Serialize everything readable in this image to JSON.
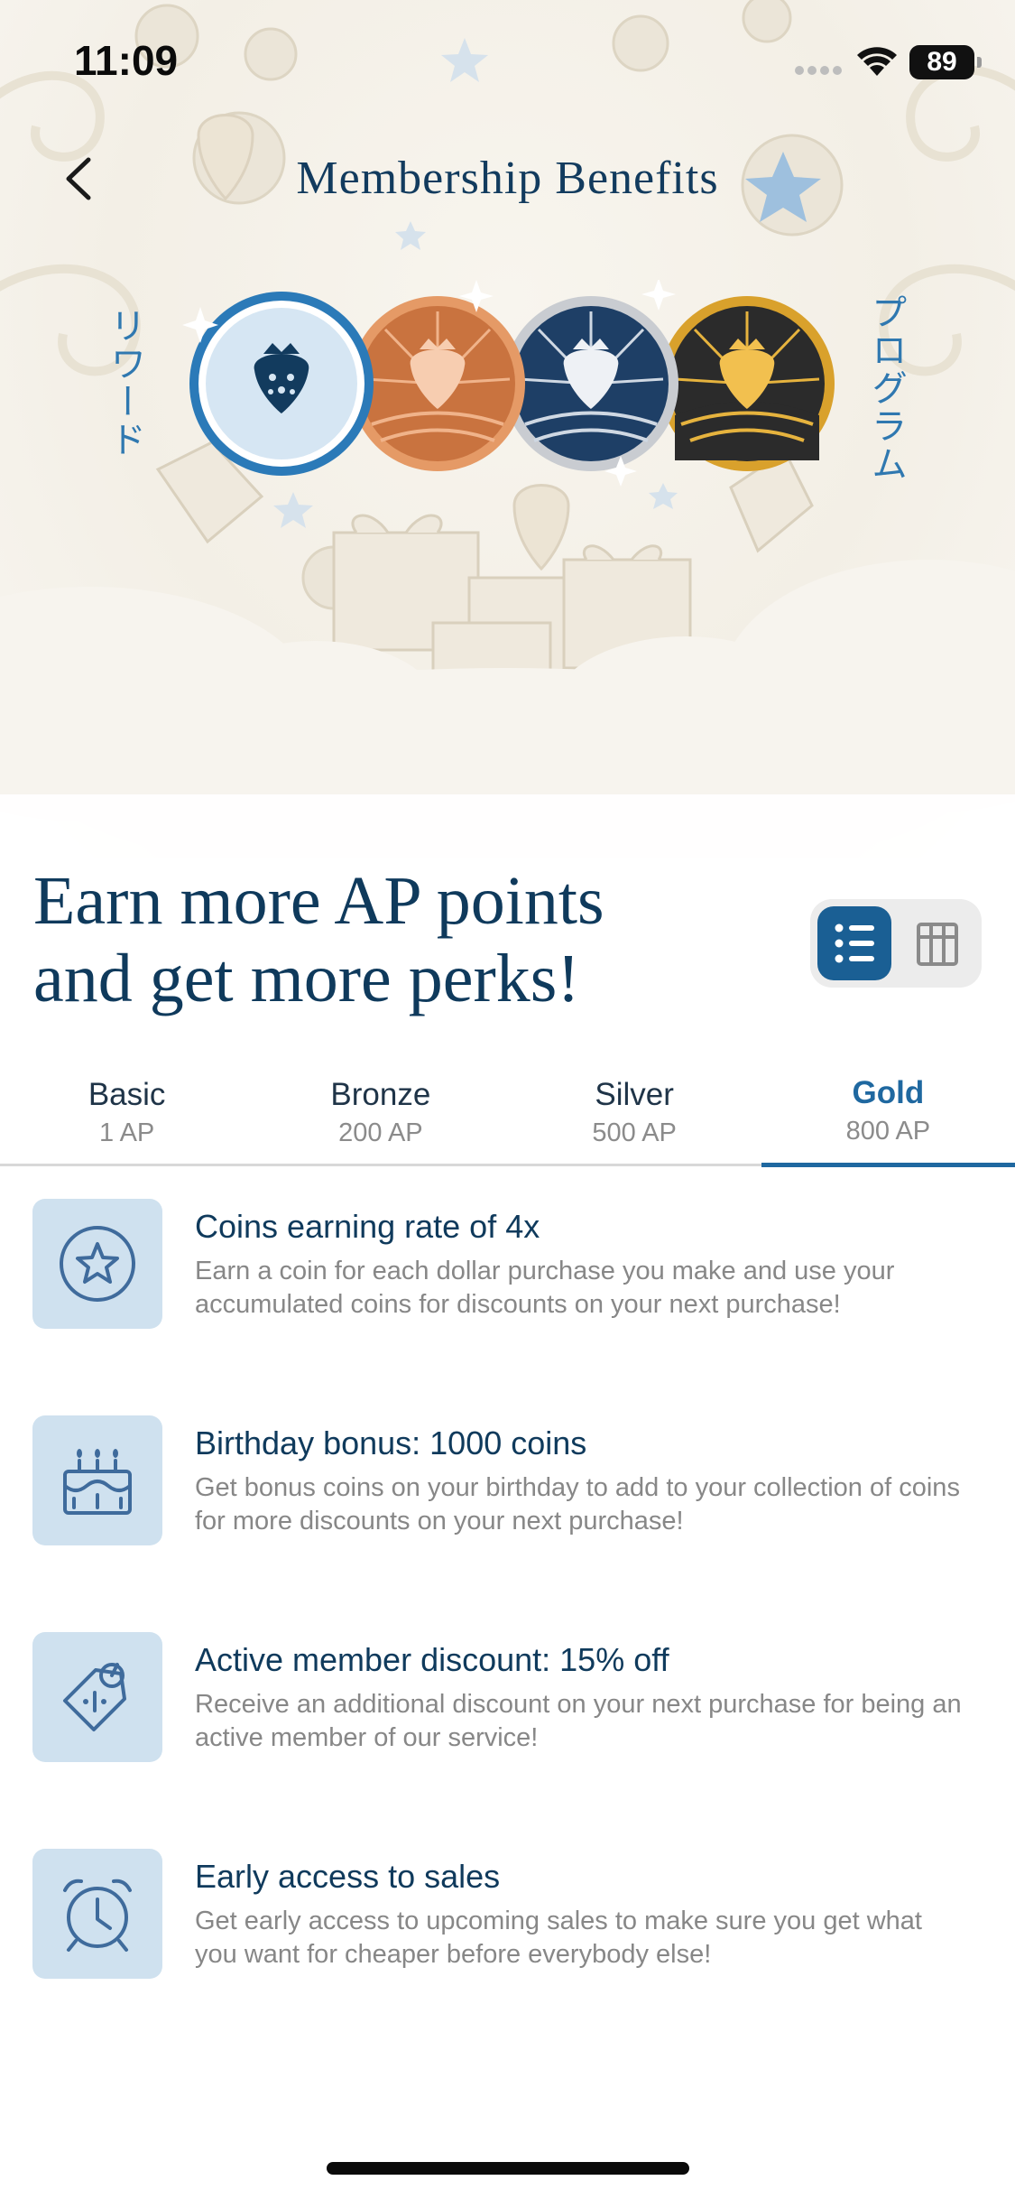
{
  "status_bar": {
    "time": "11:09",
    "battery": "89"
  },
  "header": {
    "title": "Membership Benefits",
    "back_icon": "chevron-left-icon"
  },
  "hero": {
    "left_vertical_text": "リワード",
    "right_vertical_text": "プログラム",
    "badges": [
      "basic-strawberry-badge",
      "bronze-strawberry-badge",
      "silver-strawberry-badge",
      "gold-strawberry-badge"
    ]
  },
  "headline": {
    "line1": "Earn more AP points",
    "line2": "and get more perks!"
  },
  "view_toggle": {
    "options": [
      "list-view-icon",
      "grid-view-icon"
    ],
    "selected": "list-view-icon"
  },
  "tabs": [
    {
      "name": "Basic",
      "points": "1 AP"
    },
    {
      "name": "Bronze",
      "points": "200 AP"
    },
    {
      "name": "Silver",
      "points": "500 AP"
    },
    {
      "name": "Gold",
      "points": "800 AP"
    }
  ],
  "active_tab": "Gold",
  "benefits": [
    {
      "icon": "star-coin-icon",
      "title": "Coins earning rate of 4x",
      "description": "Earn a coin for each dollar purchase you make and use your accumulated coins for discounts on your next purchase!"
    },
    {
      "icon": "birthday-cake-icon",
      "title": "Birthday bonus: 1000 coins",
      "description": "Get bonus coins on your birthday to add to your collection of coins for more discounts on your next purchase!"
    },
    {
      "icon": "discount-tag-icon",
      "title": "Active member discount: 15% off",
      "description": "Receive an additional discount on your next purchase for being an active member of our service!"
    },
    {
      "icon": "alarm-clock-icon",
      "title": "Early access to sales",
      "description": "Get early access to upcoming sales to make sure you get what you want for cheaper before everybody else!"
    }
  ],
  "colors": {
    "primary": "#1f68a0",
    "navy": "#0f3a5c",
    "icon_bg": "#cfe1ef",
    "bronze": "#c9733f",
    "silver": "#1e3f66",
    "gold": "#e6b33e"
  }
}
